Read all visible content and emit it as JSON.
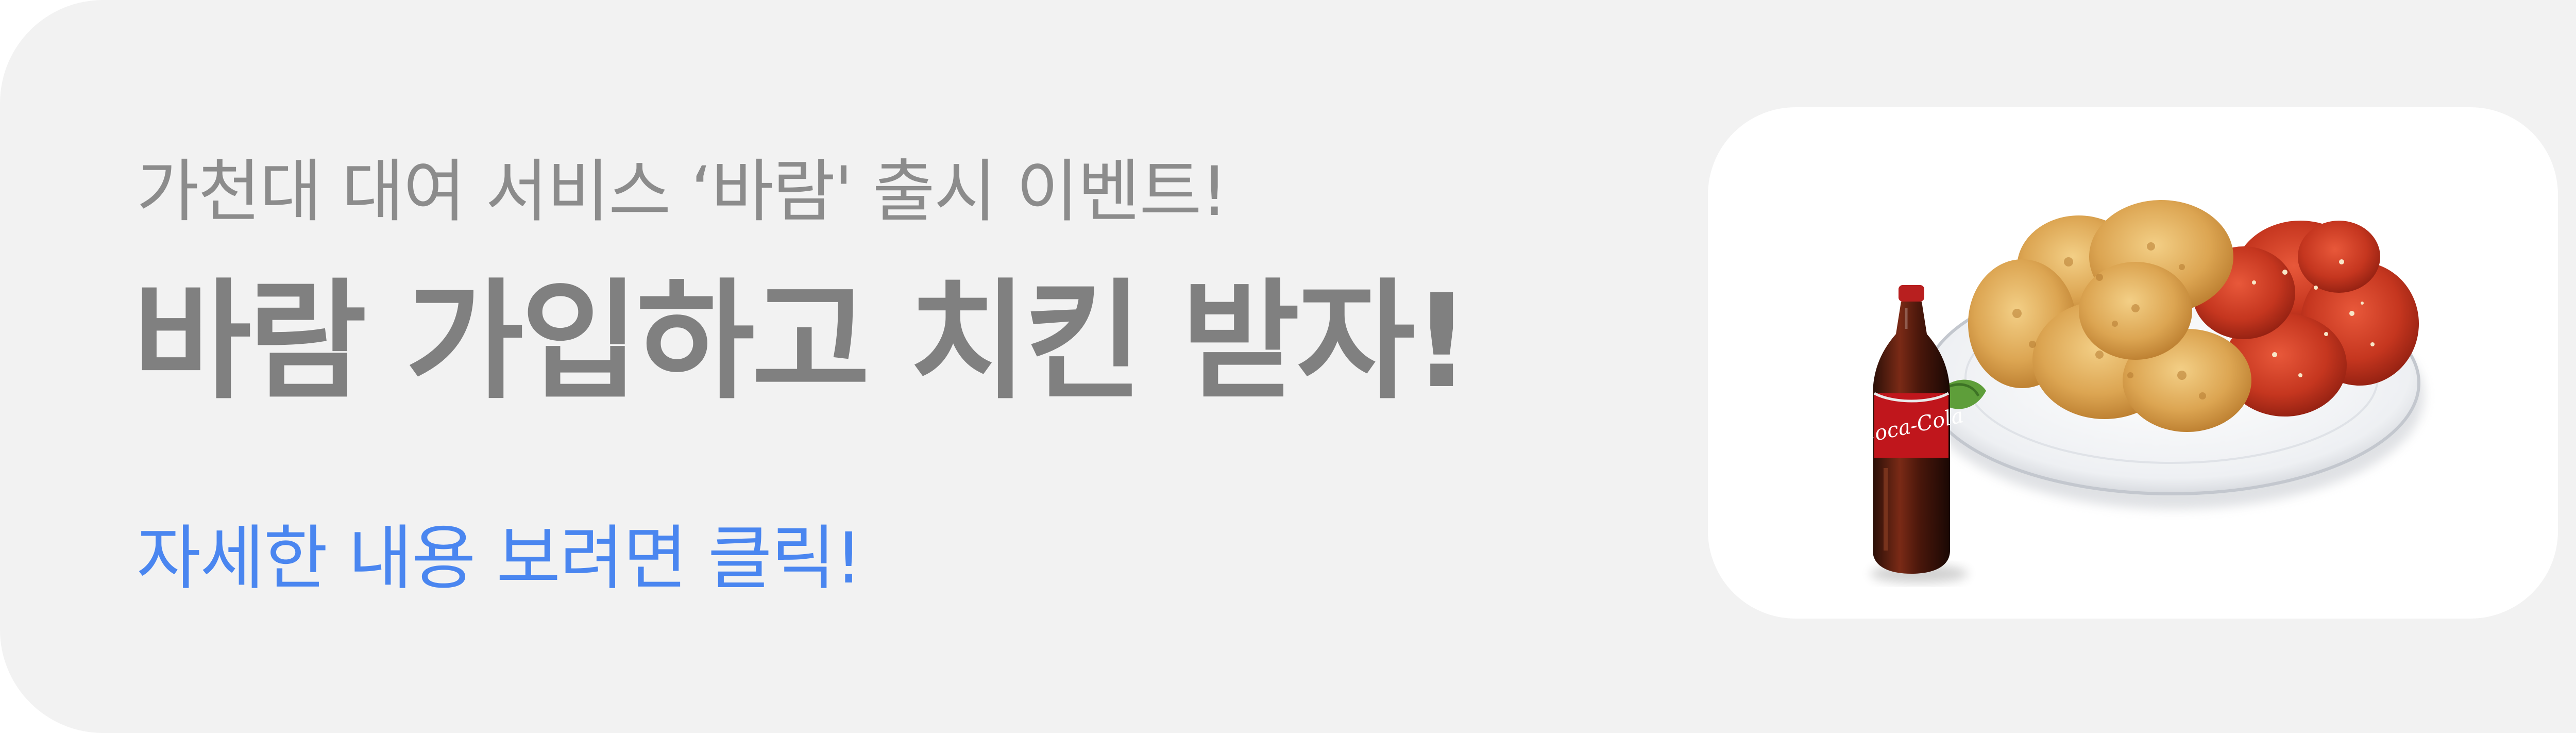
{
  "banner": {
    "subtitle": "가천대 대여 서비스 ‘바람' 출시 이벤트!",
    "headline": "바람 가입하고 치킨 받자!",
    "cta": "자세한 내용 보려면 클릭!",
    "bottle_label": "Coca-Cola"
  },
  "colors": {
    "background": "#f2f2f2",
    "subtitle": "#8c8c8c",
    "headline": "#808080",
    "cta": "#4a86f0",
    "card": "#ffffff"
  },
  "icons": {
    "product_image": "fried-chicken-and-cola-image"
  }
}
